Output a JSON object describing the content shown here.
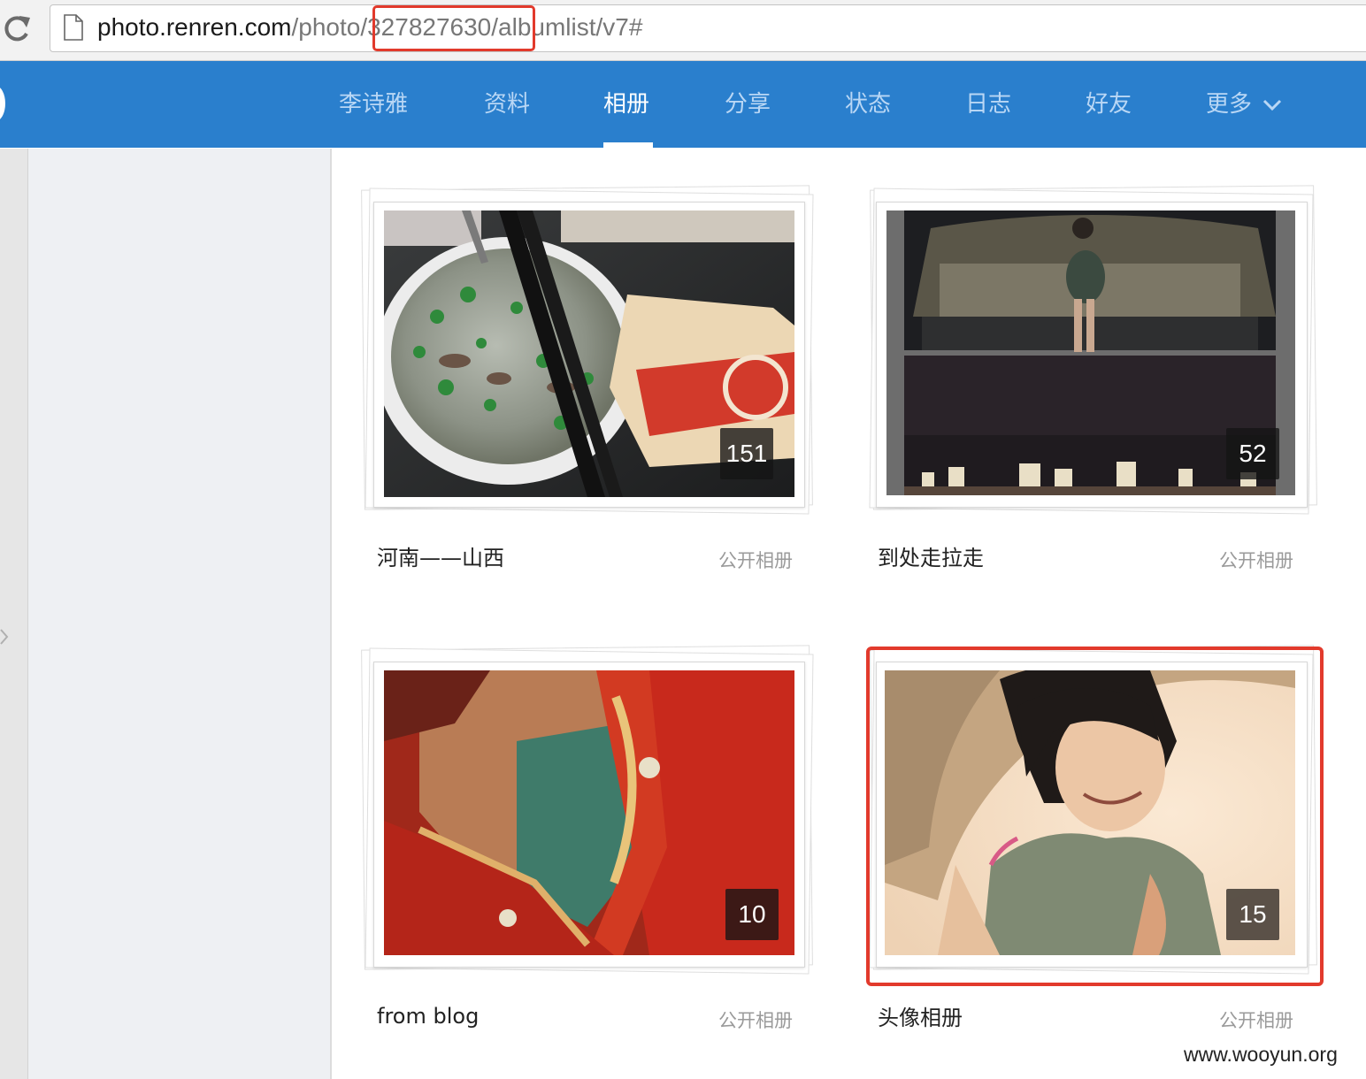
{
  "browser": {
    "url_host": "photo.renren.com",
    "url_path_before": "/photo",
    "url_id": "/327827630/",
    "url_path_after": "albumlist/v7#",
    "highlight_color": "#e23a2c"
  },
  "nav": {
    "items": [
      {
        "label": "李诗雅",
        "active": false
      },
      {
        "label": "资料",
        "active": false
      },
      {
        "label": "相册",
        "active": true
      },
      {
        "label": "分享",
        "active": false
      },
      {
        "label": "状态",
        "active": false
      },
      {
        "label": "日志",
        "active": false
      },
      {
        "label": "好友",
        "active": false
      },
      {
        "label": "更多",
        "active": false,
        "icon": "chevron-down-icon"
      }
    ],
    "background_color": "#2a7fcd"
  },
  "albums": [
    {
      "title": "河南——山西",
      "privacy": "公开相册",
      "count": "151",
      "image": "bowl-of-noodle-soup-with-chopsticks",
      "highlighted": false
    },
    {
      "title": "到处走拉走",
      "privacy": "公开相册",
      "count": "52",
      "image": "night-car-and-city-skyline-collage",
      "highlighted": false
    },
    {
      "title": "from blog",
      "privacy": "公开相册",
      "count": "10",
      "image": "red-embroidered-robe",
      "highlighted": false
    },
    {
      "title": "头像相册",
      "privacy": "公开相册",
      "count": "15",
      "image": "woman-in-straw-hat",
      "highlighted": true
    }
  ],
  "watermark": "www.wooyun.org"
}
